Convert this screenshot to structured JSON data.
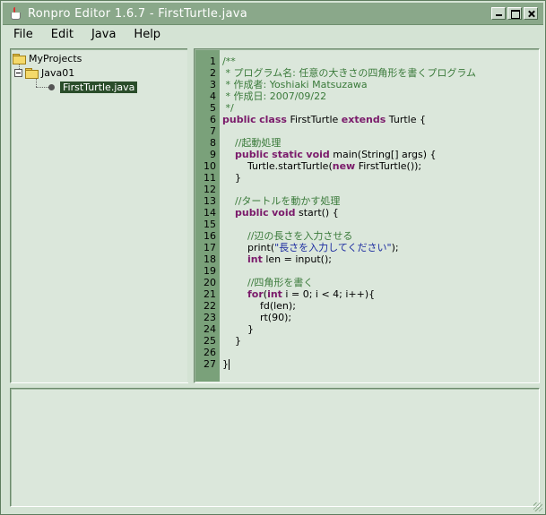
{
  "window": {
    "title": "Ronpro Editor 1.6.7 - FirstTurtle.java",
    "icon": "java-cup-icon"
  },
  "menu": [
    {
      "label": "File"
    },
    {
      "label": "Edit"
    },
    {
      "label": "Java"
    },
    {
      "label": "Help"
    }
  ],
  "tree": {
    "root": "MyProjects",
    "project": "Java01",
    "file": "FirstTurtle.java"
  },
  "editor": {
    "line_numbers": [
      "1",
      "2",
      "3",
      "4",
      "5",
      "6",
      "7",
      "8",
      "9",
      "10",
      "11",
      "12",
      "13",
      "14",
      "15",
      "16",
      "17",
      "18",
      "19",
      "20",
      "21",
      "22",
      "23",
      "24",
      "25",
      "26",
      "27"
    ],
    "lines": [
      [
        {
          "t": "/**",
          "c": "comment"
        }
      ],
      [
        {
          "t": " * プログラム名: 任意の大きさの四角形を書くプログラム",
          "c": "comment"
        }
      ],
      [
        {
          "t": " * 作成者: Yoshiaki Matsuzawa",
          "c": "comment"
        }
      ],
      [
        {
          "t": " * 作成日: 2007/09/22",
          "c": "comment"
        }
      ],
      [
        {
          "t": " */",
          "c": "comment"
        }
      ],
      [
        {
          "t": "public",
          "c": "kw"
        },
        {
          "t": " "
        },
        {
          "t": "class",
          "c": "kw"
        },
        {
          "t": " FirstTurtle "
        },
        {
          "t": "extends",
          "c": "kw"
        },
        {
          "t": " Turtle {"
        }
      ],
      [],
      [
        {
          "t": "    "
        },
        {
          "t": "//起動処理",
          "c": "comment"
        }
      ],
      [
        {
          "t": "    "
        },
        {
          "t": "public",
          "c": "kw"
        },
        {
          "t": " "
        },
        {
          "t": "static",
          "c": "kw"
        },
        {
          "t": " "
        },
        {
          "t": "void",
          "c": "kw"
        },
        {
          "t": " main(String[] args) {"
        }
      ],
      [
        {
          "t": "        Turtle.startTurtle("
        },
        {
          "t": "new",
          "c": "kw"
        },
        {
          "t": " FirstTurtle());"
        }
      ],
      [
        {
          "t": "    }"
        }
      ],
      [],
      [
        {
          "t": "    "
        },
        {
          "t": "//タートルを動かす処理",
          "c": "comment"
        }
      ],
      [
        {
          "t": "    "
        },
        {
          "t": "public",
          "c": "kw"
        },
        {
          "t": " "
        },
        {
          "t": "void",
          "c": "kw"
        },
        {
          "t": " start() {"
        }
      ],
      [],
      [
        {
          "t": "        "
        },
        {
          "t": "//辺の長さを入力させる",
          "c": "comment"
        }
      ],
      [
        {
          "t": "        print("
        },
        {
          "t": "\"長さを入力してください\"",
          "c": "str"
        },
        {
          "t": ");"
        }
      ],
      [
        {
          "t": "        "
        },
        {
          "t": "int",
          "c": "kw"
        },
        {
          "t": " len = input();"
        }
      ],
      [],
      [
        {
          "t": "        "
        },
        {
          "t": "//四角形を書く",
          "c": "comment"
        }
      ],
      [
        {
          "t": "        "
        },
        {
          "t": "for",
          "c": "kw"
        },
        {
          "t": "("
        },
        {
          "t": "int",
          "c": "kw"
        },
        {
          "t": " i = 0; i < 4; i++){"
        }
      ],
      [
        {
          "t": "            fd(len);"
        }
      ],
      [
        {
          "t": "            rt(90);"
        }
      ],
      [
        {
          "t": "        }"
        }
      ],
      [
        {
          "t": "    }"
        }
      ],
      [],
      [
        {
          "t": "}"
        }
      ]
    ]
  },
  "console": {
    "text": ""
  },
  "colors": {
    "comment": "#3a7a3a",
    "keyword": "#7a1a6a",
    "string": "#1a2aa0",
    "gutter": "#7aa17a",
    "titlebar": "#8aa88a"
  }
}
